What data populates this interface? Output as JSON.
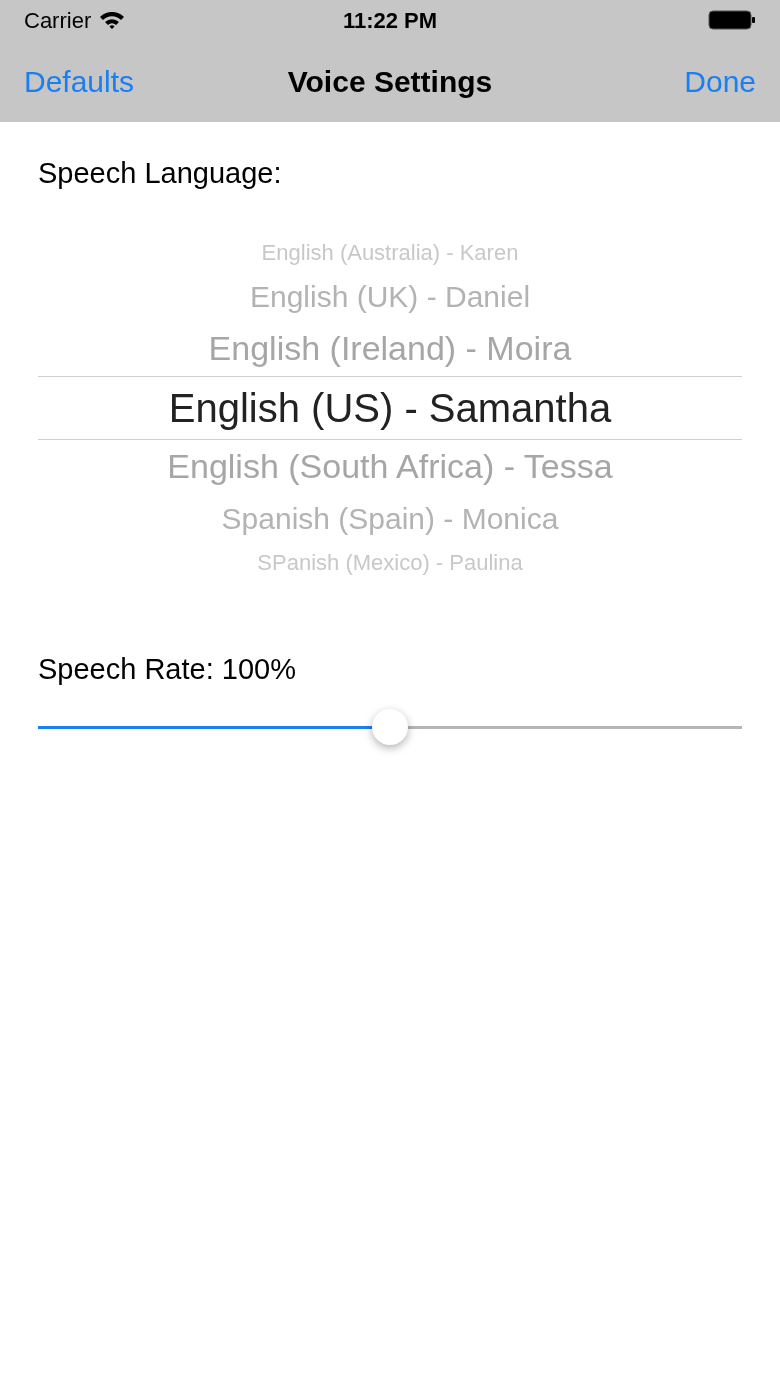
{
  "status_bar": {
    "carrier": "Carrier",
    "time": "11:22 PM"
  },
  "nav_bar": {
    "left_button": "Defaults",
    "title": "Voice Settings",
    "right_button": "Done"
  },
  "language": {
    "label": "Speech Language:",
    "options": [
      {
        "label": "English (Australia) - Karen",
        "selected": false
      },
      {
        "label": "English (UK) - Daniel",
        "selected": false
      },
      {
        "label": "English (Ireland) - Moira",
        "selected": false
      },
      {
        "label": "English (US) - Samantha",
        "selected": true
      },
      {
        "label": "English (South Africa) - Tessa",
        "selected": false
      },
      {
        "label": "Spanish (Spain) - Monica",
        "selected": false
      },
      {
        "label": "SPanish (Mexico) - Paulina",
        "selected": false
      }
    ]
  },
  "rate": {
    "label": "Speech Rate: 100%",
    "level": 0.5
  }
}
